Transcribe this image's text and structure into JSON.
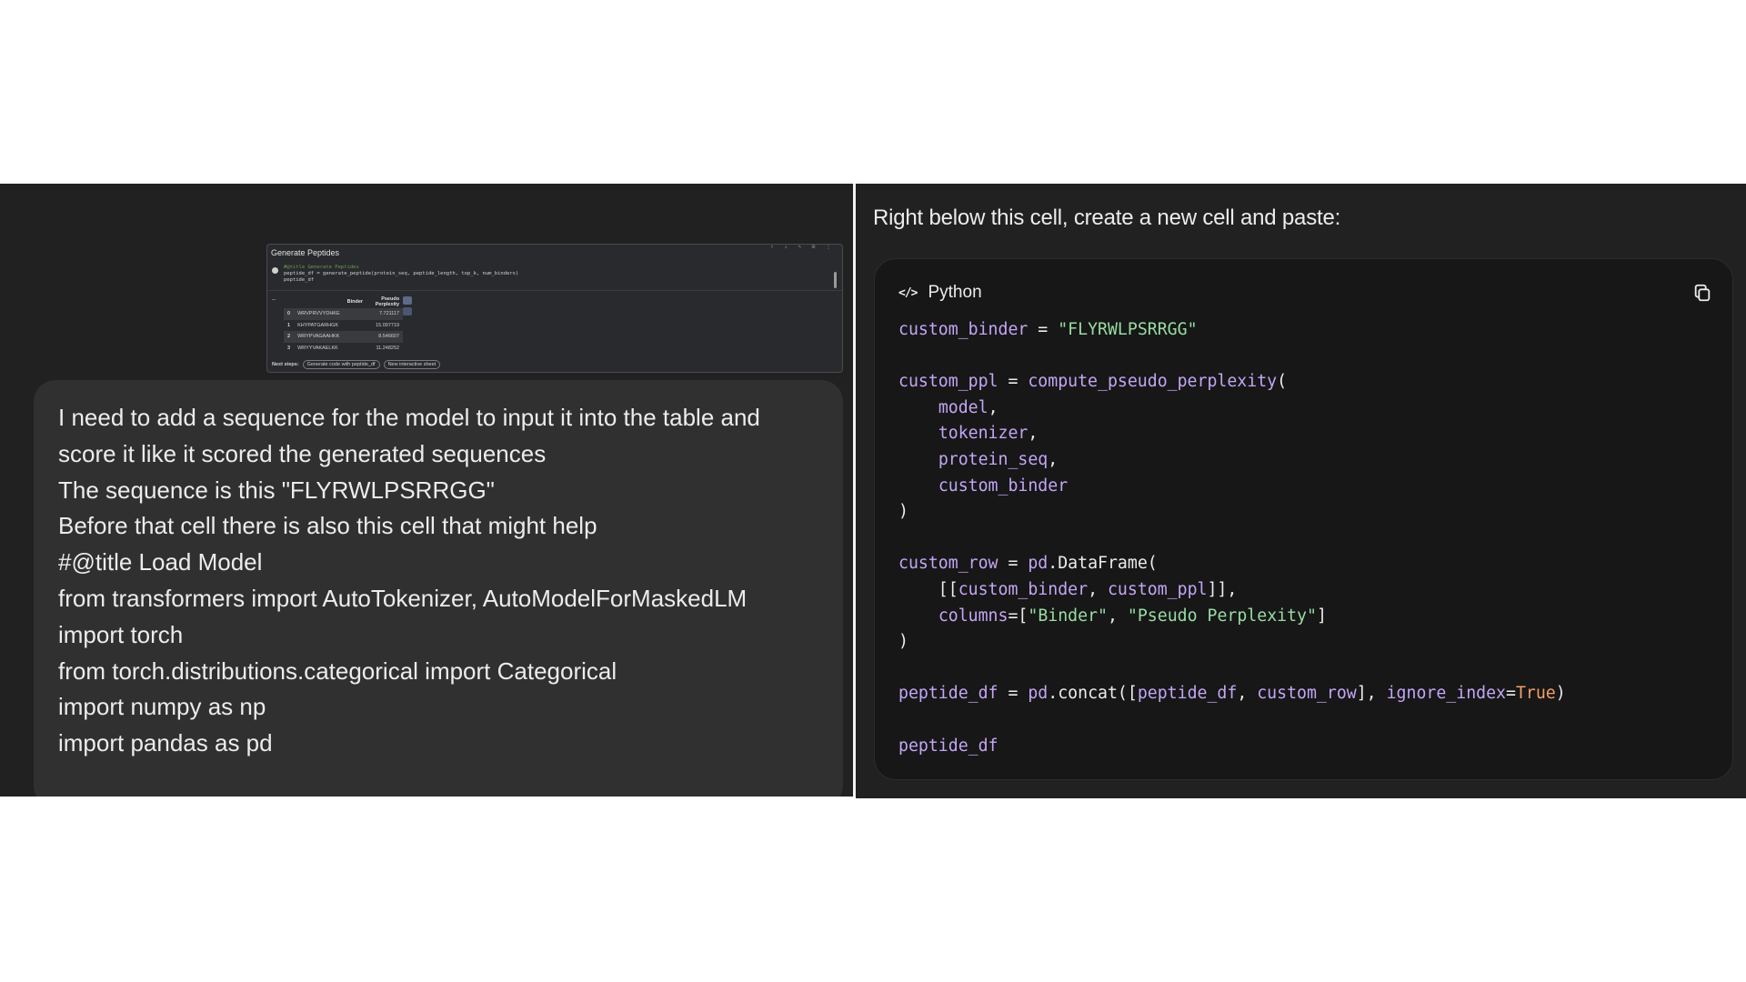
{
  "thumbnail": {
    "title": "Generate Peptides",
    "toolbar_icons": "↑ ↓ ✎ ⊞ ⋮",
    "code_lines": [
      "#@title Generate Peptides",
      "peptide_df = generate_peptide(protein_seq, peptide_length, top_k, num_binders)",
      "peptide_df"
    ],
    "table": {
      "headers": [
        "",
        "Binder",
        "Pseudo Perplexity"
      ],
      "rows": [
        [
          "0",
          "WRVPRVVYDHKE",
          "7.721117"
        ],
        [
          "1",
          "KHYPATGARHGK",
          "15.097719"
        ],
        [
          "2",
          "WRYPVAGAAHKK",
          "8.546607"
        ],
        [
          "3",
          "WRYYVAKAELKK",
          "11.248252"
        ]
      ]
    },
    "next_steps_label": "Next steps:",
    "next_steps_chips": [
      "Generate code with peptide_df",
      "New interactive sheet"
    ]
  },
  "user_message": {
    "lines": [
      "I need to add a sequence for the model to input it into the table and",
      "score it like it scored the generated sequences",
      "The sequence is this \"FLYRWLPSRRGG\"",
      "Before that cell there is also this cell that might help",
      "#@title Load Model",
      "from transformers import AutoTokenizer, AutoModelForMaskedLM",
      "import torch",
      "from torch.distributions.categorical import Categorical",
      "import numpy as np",
      "import pandas as pd"
    ]
  },
  "assistant": {
    "instruction": "Right below this cell, create a new cell and paste:",
    "code_block": {
      "language": "Python",
      "lang_icon": "</>",
      "copy_icon": "copy-icon",
      "lines": [
        [
          [
            "v",
            "custom_binder"
          ],
          [
            "p",
            " = "
          ],
          [
            "s",
            "\"FLYRWLPSRRGG\""
          ]
        ],
        [],
        [
          [
            "v",
            "custom_ppl"
          ],
          [
            "p",
            " = "
          ],
          [
            "v",
            "compute_pseudo_perplexity"
          ],
          [
            "p",
            "("
          ]
        ],
        [
          [
            "p",
            "    "
          ],
          [
            "v",
            "model"
          ],
          [
            "p",
            ","
          ]
        ],
        [
          [
            "p",
            "    "
          ],
          [
            "v",
            "tokenizer"
          ],
          [
            "p",
            ","
          ]
        ],
        [
          [
            "p",
            "    "
          ],
          [
            "v",
            "protein_seq"
          ],
          [
            "p",
            ","
          ]
        ],
        [
          [
            "p",
            "    "
          ],
          [
            "v",
            "custom_binder"
          ]
        ],
        [
          [
            "p",
            ")"
          ]
        ],
        [],
        [
          [
            "v",
            "custom_row"
          ],
          [
            "p",
            " = "
          ],
          [
            "v",
            "pd"
          ],
          [
            "p",
            ".DataFrame("
          ]
        ],
        [
          [
            "p",
            "    [["
          ],
          [
            "v",
            "custom_binder"
          ],
          [
            "p",
            ", "
          ],
          [
            "v",
            "custom_ppl"
          ],
          [
            "p",
            "]],"
          ]
        ],
        [
          [
            "p",
            "    "
          ],
          [
            "v",
            "columns"
          ],
          [
            "p",
            "=["
          ],
          [
            "s",
            "\"Binder\""
          ],
          [
            "p",
            ", "
          ],
          [
            "s",
            "\"Pseudo Perplexity\""
          ],
          [
            "p",
            "]"
          ]
        ],
        [
          [
            "p",
            ")"
          ]
        ],
        [],
        [
          [
            "v",
            "peptide_df"
          ],
          [
            "p",
            " = "
          ],
          [
            "v",
            "pd"
          ],
          [
            "p",
            ".concat(["
          ],
          [
            "v",
            "peptide_df"
          ],
          [
            "p",
            ", "
          ],
          [
            "v",
            "custom_row"
          ],
          [
            "p",
            "], "
          ],
          [
            "v",
            "ignore_index"
          ],
          [
            "p",
            "="
          ],
          [
            "k",
            "True"
          ],
          [
            "p",
            ")"
          ]
        ],
        [],
        [
          [
            "v",
            "peptide_df"
          ]
        ]
      ]
    }
  }
}
